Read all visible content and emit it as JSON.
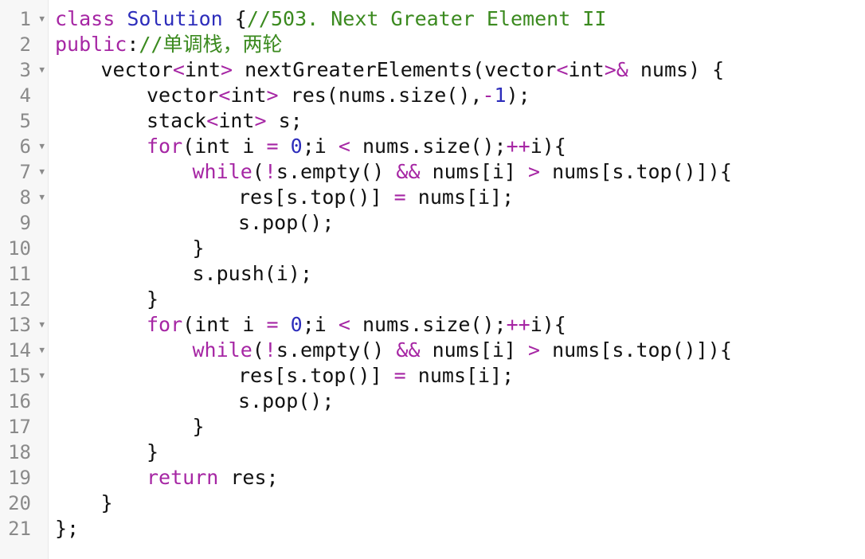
{
  "lines": [
    {
      "num": "1",
      "fold": true,
      "indent": 0,
      "tokens": [
        {
          "t": "class",
          "k": "keyword"
        },
        {
          "t": " ",
          "k": "plain"
        },
        {
          "t": "Solution",
          "k": "class"
        },
        {
          "t": " {",
          "k": "plain"
        },
        {
          "t": "//503. Next Greater Element II",
          "k": "comment"
        }
      ]
    },
    {
      "num": "2",
      "fold": false,
      "indent": 0,
      "tokens": [
        {
          "t": "public",
          "k": "keyword"
        },
        {
          "t": ":",
          "k": "plain"
        },
        {
          "t": "//单调栈，两轮",
          "k": "comment"
        }
      ]
    },
    {
      "num": "3",
      "fold": true,
      "indent": 1,
      "tokens": [
        {
          "t": "vector",
          "k": "plain"
        },
        {
          "t": "<",
          "k": "op"
        },
        {
          "t": "int",
          "k": "plain"
        },
        {
          "t": ">",
          "k": "op"
        },
        {
          "t": " nextGreaterElements(vector",
          "k": "plain"
        },
        {
          "t": "<",
          "k": "op"
        },
        {
          "t": "int",
          "k": "plain"
        },
        {
          "t": ">&",
          "k": "op"
        },
        {
          "t": " nums) {",
          "k": "plain"
        }
      ]
    },
    {
      "num": "4",
      "fold": false,
      "indent": 2,
      "tokens": [
        {
          "t": "vector",
          "k": "plain"
        },
        {
          "t": "<",
          "k": "op"
        },
        {
          "t": "int",
          "k": "plain"
        },
        {
          "t": ">",
          "k": "op"
        },
        {
          "t": " res(nums.size(),",
          "k": "plain"
        },
        {
          "t": "-",
          "k": "op"
        },
        {
          "t": "1",
          "k": "number"
        },
        {
          "t": ");",
          "k": "plain"
        }
      ]
    },
    {
      "num": "5",
      "fold": false,
      "indent": 2,
      "tokens": [
        {
          "t": "stack",
          "k": "plain"
        },
        {
          "t": "<",
          "k": "op"
        },
        {
          "t": "int",
          "k": "plain"
        },
        {
          "t": ">",
          "k": "op"
        },
        {
          "t": " s;",
          "k": "plain"
        }
      ]
    },
    {
      "num": "6",
      "fold": true,
      "indent": 2,
      "tokens": [
        {
          "t": "for",
          "k": "keyword"
        },
        {
          "t": "(int i ",
          "k": "plain"
        },
        {
          "t": "=",
          "k": "op"
        },
        {
          "t": " ",
          "k": "plain"
        },
        {
          "t": "0",
          "k": "number"
        },
        {
          "t": ";i ",
          "k": "plain"
        },
        {
          "t": "<",
          "k": "op"
        },
        {
          "t": " nums.size();",
          "k": "plain"
        },
        {
          "t": "++",
          "k": "op"
        },
        {
          "t": "i){",
          "k": "plain"
        }
      ]
    },
    {
      "num": "7",
      "fold": true,
      "indent": 3,
      "tokens": [
        {
          "t": "while",
          "k": "keyword"
        },
        {
          "t": "(",
          "k": "plain"
        },
        {
          "t": "!",
          "k": "op"
        },
        {
          "t": "s.empty() ",
          "k": "plain"
        },
        {
          "t": "&&",
          "k": "op"
        },
        {
          "t": " nums[i] ",
          "k": "plain"
        },
        {
          "t": ">",
          "k": "op"
        },
        {
          "t": " nums[s.top()]){",
          "k": "plain"
        }
      ]
    },
    {
      "num": "8",
      "fold": true,
      "indent": 4,
      "tokens": [
        {
          "t": "res[s.top()] ",
          "k": "plain"
        },
        {
          "t": "=",
          "k": "op"
        },
        {
          "t": " nums[i];",
          "k": "plain"
        }
      ]
    },
    {
      "num": "9",
      "fold": false,
      "indent": 4,
      "tokens": [
        {
          "t": "s.pop();",
          "k": "plain"
        }
      ]
    },
    {
      "num": "10",
      "fold": false,
      "indent": 3,
      "tokens": [
        {
          "t": "}",
          "k": "plain"
        }
      ]
    },
    {
      "num": "11",
      "fold": false,
      "indent": 3,
      "tokens": [
        {
          "t": "s.push(i);",
          "k": "plain"
        }
      ]
    },
    {
      "num": "12",
      "fold": false,
      "indent": 2,
      "tokens": [
        {
          "t": "}",
          "k": "plain"
        }
      ]
    },
    {
      "num": "13",
      "fold": true,
      "indent": 2,
      "tokens": [
        {
          "t": "for",
          "k": "keyword"
        },
        {
          "t": "(int i ",
          "k": "plain"
        },
        {
          "t": "=",
          "k": "op"
        },
        {
          "t": " ",
          "k": "plain"
        },
        {
          "t": "0",
          "k": "number"
        },
        {
          "t": ";i ",
          "k": "plain"
        },
        {
          "t": "<",
          "k": "op"
        },
        {
          "t": " nums.size();",
          "k": "plain"
        },
        {
          "t": "++",
          "k": "op"
        },
        {
          "t": "i){",
          "k": "plain"
        }
      ]
    },
    {
      "num": "14",
      "fold": true,
      "indent": 3,
      "tokens": [
        {
          "t": "while",
          "k": "keyword"
        },
        {
          "t": "(",
          "k": "plain"
        },
        {
          "t": "!",
          "k": "op"
        },
        {
          "t": "s.empty() ",
          "k": "plain"
        },
        {
          "t": "&&",
          "k": "op"
        },
        {
          "t": " nums[i] ",
          "k": "plain"
        },
        {
          "t": ">",
          "k": "op"
        },
        {
          "t": " nums[s.top()]){",
          "k": "plain"
        }
      ]
    },
    {
      "num": "15",
      "fold": true,
      "indent": 4,
      "tokens": [
        {
          "t": "res[s.top()] ",
          "k": "plain"
        },
        {
          "t": "=",
          "k": "op"
        },
        {
          "t": " nums[i];",
          "k": "plain"
        }
      ]
    },
    {
      "num": "16",
      "fold": false,
      "indent": 4,
      "tokens": [
        {
          "t": "s.pop();",
          "k": "plain"
        }
      ]
    },
    {
      "num": "17",
      "fold": false,
      "indent": 3,
      "tokens": [
        {
          "t": "}",
          "k": "plain"
        }
      ]
    },
    {
      "num": "18",
      "fold": false,
      "indent": 2,
      "tokens": [
        {
          "t": "}",
          "k": "plain"
        }
      ]
    },
    {
      "num": "19",
      "fold": false,
      "indent": 2,
      "tokens": [
        {
          "t": "return",
          "k": "keyword"
        },
        {
          "t": " res;",
          "k": "plain"
        }
      ]
    },
    {
      "num": "20",
      "fold": false,
      "indent": 1,
      "tokens": [
        {
          "t": "}",
          "k": "plain"
        }
      ]
    },
    {
      "num": "21",
      "fold": false,
      "indent": 0,
      "tokens": [
        {
          "t": "};",
          "k": "plain"
        }
      ]
    }
  ],
  "fold_glyph": "▼"
}
